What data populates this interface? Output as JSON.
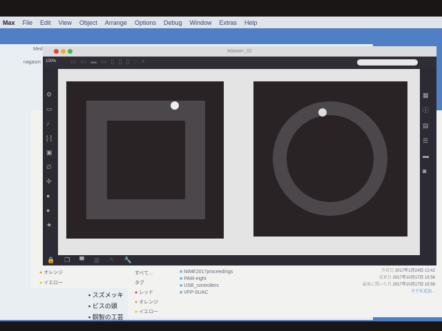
{
  "menubar": {
    "app": "Max",
    "items": [
      "File",
      "Edit",
      "View",
      "Object",
      "Arrange",
      "Options",
      "Debug",
      "Window",
      "Extras",
      "Help"
    ]
  },
  "browser": {
    "tab": "Med",
    "address": "nagasm"
  },
  "maxwin": {
    "title": "Maxwin_02",
    "zoom": "100%"
  },
  "finder": {
    "all_label": "すべて...",
    "tags_header": "タグ",
    "tags": [
      {
        "name": "レッド",
        "color": "#d8383e"
      },
      {
        "name": "オレンジ",
        "color": "#e39a2a"
      },
      {
        "name": "イエロー",
        "color": "#d9c82a"
      }
    ],
    "folders": [
      "NIME2017proceedings",
      "PAW-eight",
      "USB_controllers",
      "VFP-SUAC"
    ],
    "info": [
      {
        "label": "作成日",
        "value": "2017年1月24日 13:42"
      },
      {
        "label": "変更日",
        "value": "2017年10月17日 15:58"
      },
      {
        "label": "最後に開いた日",
        "value": "2017年10月17日 15:58"
      }
    ],
    "add_tag": "タグを追加..."
  },
  "bullets": [
    "スズメッキ",
    "ビスの頭",
    "銅製の工芸"
  ]
}
